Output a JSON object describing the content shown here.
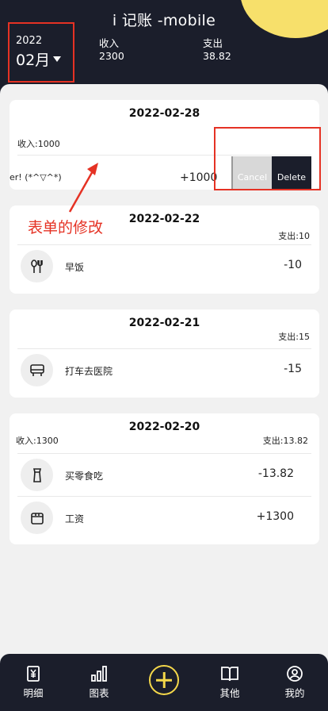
{
  "header": {
    "title": "i 记账 -mobile",
    "year": "2022",
    "month": "02月",
    "income_label": "收入",
    "income_value": "2300",
    "expense_label": "支出",
    "expense_value": "38.82"
  },
  "annotation": {
    "note": "表单的修改"
  },
  "cards": [
    {
      "date": "2022-02-28",
      "income": "收入:1000",
      "swipe_row": {
        "text": "er!  (*^▽^*)",
        "amount": "+1000",
        "cancel_label": "Cancel",
        "delete_label": "Delete"
      }
    },
    {
      "date": "2022-02-22",
      "expense": "支出:10",
      "rows": [
        {
          "icon": "utensils-icon",
          "name": "早饭",
          "amount": "-10"
        }
      ]
    },
    {
      "date": "2022-02-21",
      "expense": "支出:15",
      "rows": [
        {
          "icon": "car-icon",
          "name": "打车去医院",
          "amount": "-15"
        }
      ]
    },
    {
      "date": "2022-02-20",
      "income": "收入:1300",
      "expense": "支出:13.82",
      "rows": [
        {
          "icon": "snack-icon",
          "name": "买零食吃",
          "amount": "-13.82"
        },
        {
          "icon": "wallet-icon",
          "name": "工资",
          "amount": "+1300"
        }
      ]
    }
  ],
  "tabbar": {
    "detail": "明细",
    "chart": "图表",
    "other": "其他",
    "mine": "我的"
  },
  "colors": {
    "dark": "#1b1e2b",
    "accent": "#f5d84a",
    "annotation": "#e53224"
  }
}
